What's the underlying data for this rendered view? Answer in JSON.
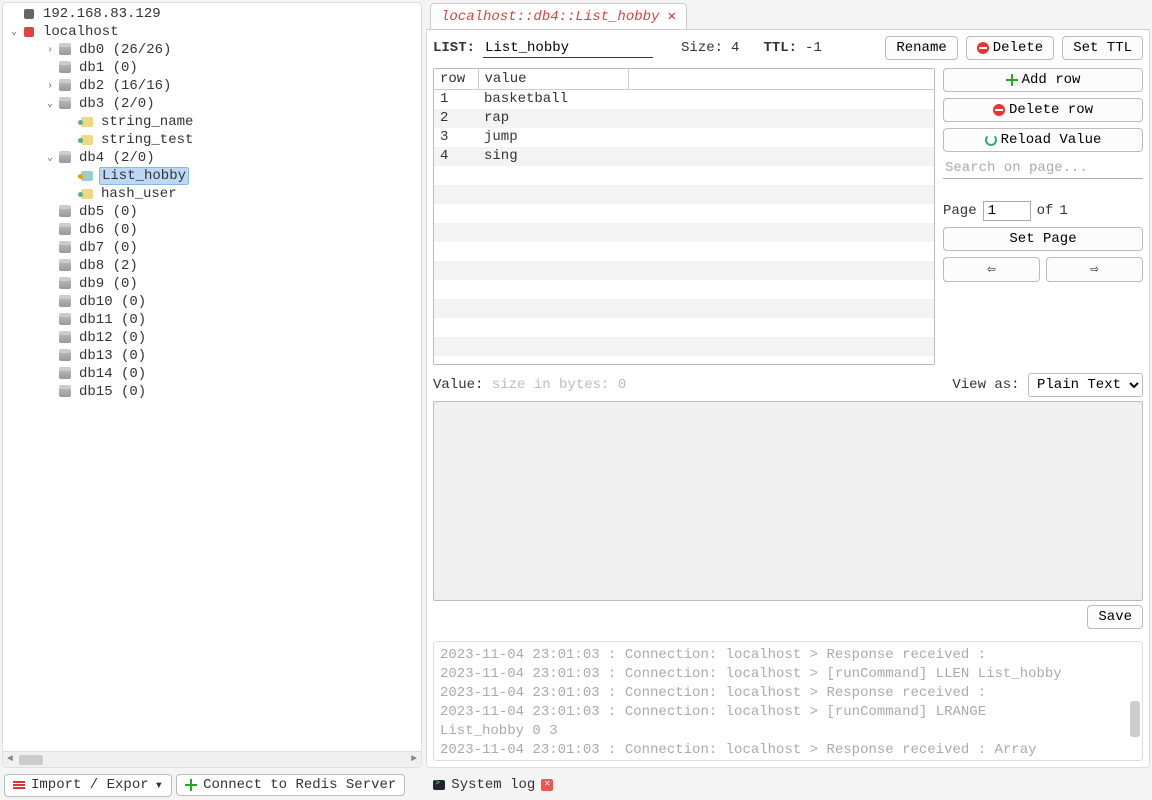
{
  "tree": {
    "server_ip": "192.168.83.129",
    "server_local": "localhost",
    "databases": [
      {
        "name": "db0  (26/26)",
        "leaf": true,
        "indent": 2,
        "arrow": "›"
      },
      {
        "name": "db1  (0)",
        "leaf": true,
        "indent": 2,
        "arrow": ""
      },
      {
        "name": "db2  (16/16)",
        "leaf": true,
        "indent": 2,
        "arrow": "›"
      },
      {
        "name": "db3  (2/0)",
        "leaf": false,
        "indent": 2,
        "arrow": "⌄",
        "children": [
          {
            "name": "string_name",
            "type": "key"
          },
          {
            "name": "string_test",
            "type": "key"
          }
        ]
      },
      {
        "name": "db4  (2/0)",
        "leaf": false,
        "indent": 2,
        "arrow": "⌄",
        "children": [
          {
            "name": "List_hobby",
            "type": "list",
            "selected": true
          },
          {
            "name": "hash_user",
            "type": "key"
          }
        ]
      },
      {
        "name": "db5  (0)",
        "leaf": true,
        "indent": 2,
        "arrow": ""
      },
      {
        "name": "db6  (0)",
        "leaf": true,
        "indent": 2,
        "arrow": ""
      },
      {
        "name": "db7  (0)",
        "leaf": true,
        "indent": 2,
        "arrow": ""
      },
      {
        "name": "db8  (2)",
        "leaf": true,
        "indent": 2,
        "arrow": ""
      },
      {
        "name": "db9  (0)",
        "leaf": true,
        "indent": 2,
        "arrow": ""
      },
      {
        "name": "db10  (0)",
        "leaf": true,
        "indent": 2,
        "arrow": ""
      },
      {
        "name": "db11  (0)",
        "leaf": true,
        "indent": 2,
        "arrow": ""
      },
      {
        "name": "db12  (0)",
        "leaf": true,
        "indent": 2,
        "arrow": ""
      },
      {
        "name": "db13  (0)",
        "leaf": true,
        "indent": 2,
        "arrow": ""
      },
      {
        "name": "db14  (0)",
        "leaf": true,
        "indent": 2,
        "arrow": ""
      },
      {
        "name": "db15  (0)",
        "leaf": true,
        "indent": 2,
        "arrow": ""
      }
    ]
  },
  "tab": {
    "title": "localhost::db4::List_hobby"
  },
  "keybar": {
    "type_label": "LIST:",
    "key_name": "List_hobby",
    "size_label": "Size:",
    "size_value": "4",
    "ttl_label": "TTL:",
    "ttl_value": "-1",
    "rename": "Rename",
    "delete": "Delete",
    "set_ttl": "Set TTL"
  },
  "list_table": {
    "col_row": "row",
    "col_value": "value",
    "rows": [
      {
        "row": "1",
        "value": "basketball"
      },
      {
        "row": "2",
        "value": "rap"
      },
      {
        "row": "3",
        "value": "jump"
      },
      {
        "row": "4",
        "value": "sing"
      }
    ]
  },
  "side": {
    "add_row": "Add row",
    "delete_row": "Delete row",
    "reload": "Reload Value",
    "search_placeholder": "Search on page...",
    "page_label": "Page",
    "page_value": "1",
    "of_label": "of",
    "page_total": "1",
    "set_page": "Set Page",
    "prev": "⇦",
    "next": "⇨"
  },
  "value_section": {
    "label": "Value:",
    "size_hint": "size in bytes: 0",
    "view_as_label": "View as:",
    "view_as_value": "Plain Text",
    "save": "Save"
  },
  "log": [
    "2023-11-04 23:01:03 : Connection: localhost > Response received :",
    "2023-11-04 23:01:03 : Connection: localhost > [runCommand] LLEN List_hobby",
    "2023-11-04 23:01:03 : Connection: localhost > Response received :",
    "2023-11-04 23:01:03 : Connection: localhost > [runCommand] LRANGE",
    "List_hobby 0 3",
    "2023-11-04 23:01:03 : Connection: localhost > Response received : Array"
  ],
  "bottom": {
    "import_export": "Import / Expor",
    "connect": "Connect to Redis Server",
    "system_log": "System log"
  }
}
